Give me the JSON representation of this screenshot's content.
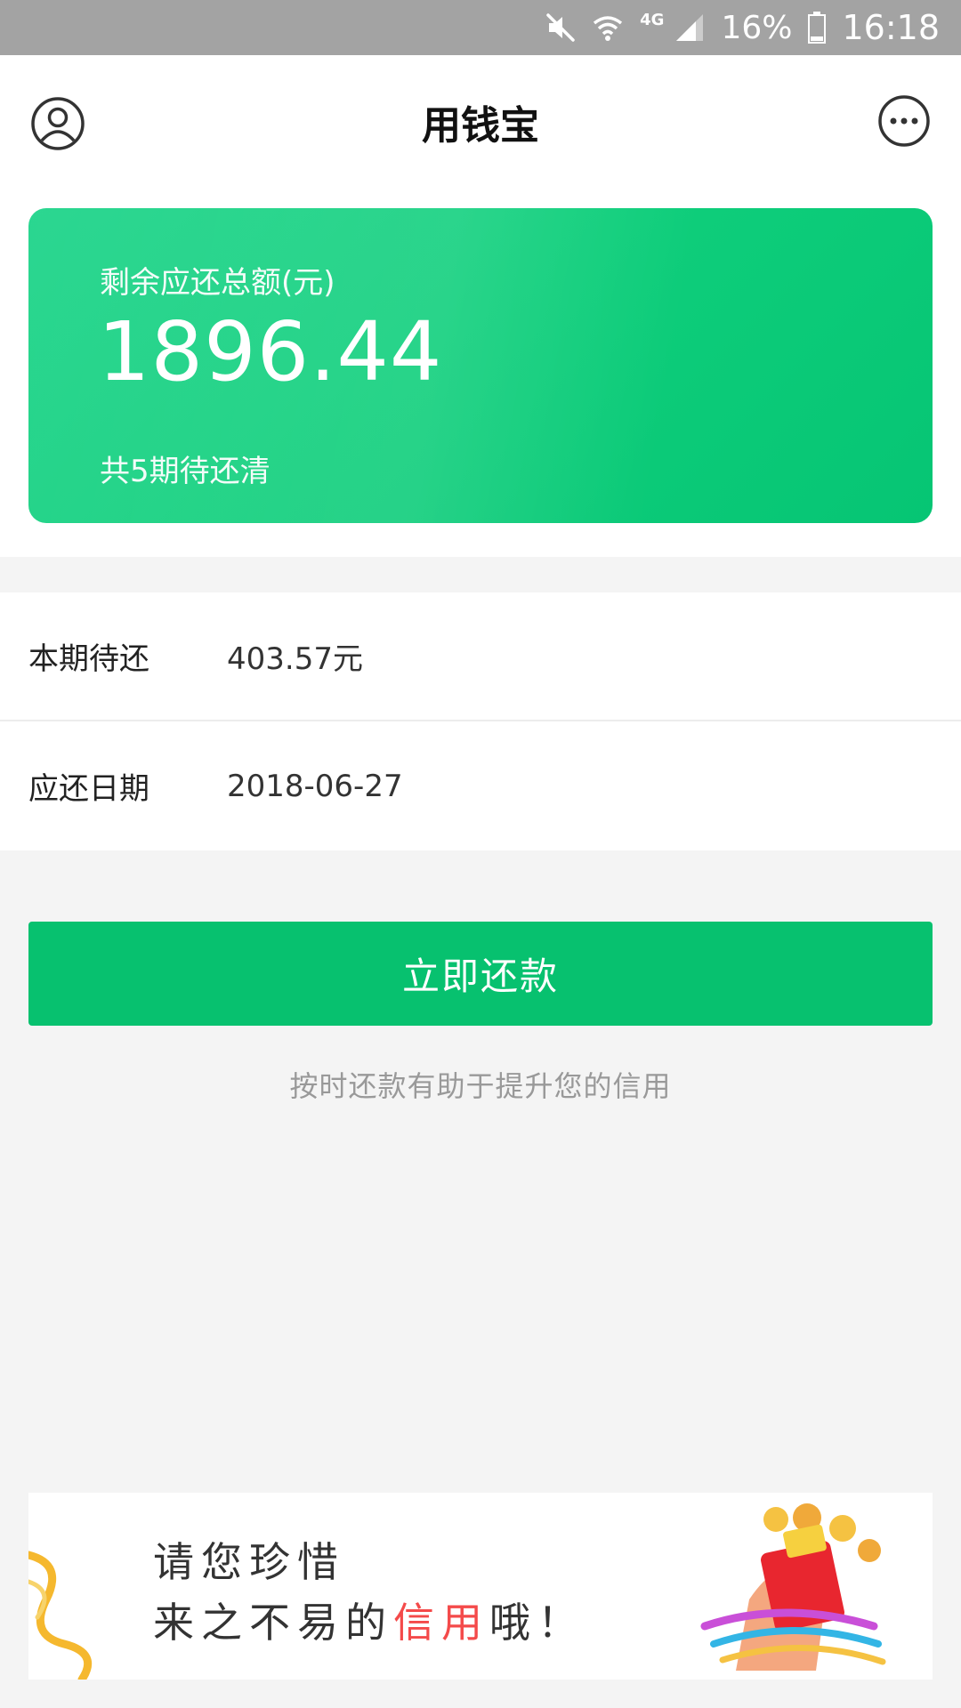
{
  "status_bar": {
    "network": "4G",
    "battery": "16%",
    "time": "16:18",
    "icons": [
      "mute-icon",
      "wifi-icon",
      "signal-icon",
      "battery-icon"
    ]
  },
  "header": {
    "title": "用钱宝",
    "left_icon": "profile-icon",
    "right_icon": "more-icon"
  },
  "summary": {
    "label": "剩余应还总额(元)",
    "amount": "1896.44",
    "periods": "共5期待还清",
    "accent_color": "#10cf7c"
  },
  "info": {
    "current_label": "本期待还",
    "current_value": "403.57元",
    "due_label": "应还日期",
    "due_value": "2018-06-27"
  },
  "actions": {
    "repay_label": "立即还款",
    "tip": "按时还款有助于提升您的信用",
    "button_color": "#07c16f"
  },
  "banner": {
    "line1": "请您珍惜",
    "line2_prefix": "来之不易的",
    "line2_highlight": "信用",
    "line2_suffix": "哦！",
    "highlight_color": "#f44a4a"
  }
}
